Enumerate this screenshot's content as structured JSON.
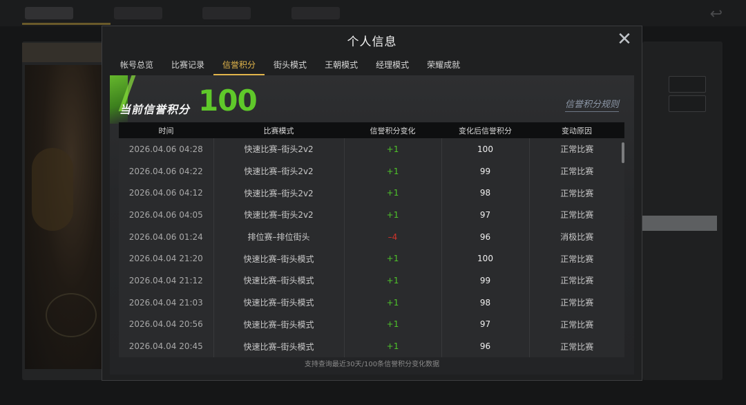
{
  "modal": {
    "title": "个人信息",
    "close_label": "✕",
    "tabs": [
      {
        "label": "帐号总览"
      },
      {
        "label": "比赛记录"
      },
      {
        "label": "信誉积分",
        "active": true
      },
      {
        "label": "街头模式"
      },
      {
        "label": "王朝模式"
      },
      {
        "label": "经理模式"
      },
      {
        "label": "荣耀成就"
      }
    ]
  },
  "credit": {
    "label": "当前信誉积分",
    "value": "100",
    "rules_link": "信誉积分规则"
  },
  "table": {
    "headers": [
      "时间",
      "比赛模式",
      "信誉积分变化",
      "变化后信誉积分",
      "变动原因"
    ],
    "rows": [
      {
        "time": "2026.04.06  04:28",
        "mode": "快速比赛–街头2v2",
        "change": "+1",
        "after": "100",
        "reason": "正常比赛"
      },
      {
        "time": "2026.04.06  04:22",
        "mode": "快速比赛–街头2v2",
        "change": "+1",
        "after": "99",
        "reason": "正常比赛"
      },
      {
        "time": "2026.04.06  04:12",
        "mode": "快速比赛–街头2v2",
        "change": "+1",
        "after": "98",
        "reason": "正常比赛"
      },
      {
        "time": "2026.04.06  04:05",
        "mode": "快速比赛–街头2v2",
        "change": "+1",
        "after": "97",
        "reason": "正常比赛"
      },
      {
        "time": "2026.04.06  01:24",
        "mode": "排位赛–排位街头",
        "change": "–4",
        "after": "96",
        "reason": "消极比赛"
      },
      {
        "time": "2026.04.04  21:20",
        "mode": "快速比赛–街头模式",
        "change": "+1",
        "after": "100",
        "reason": "正常比赛"
      },
      {
        "time": "2026.04.04  21:12",
        "mode": "快速比赛–街头模式",
        "change": "+1",
        "after": "99",
        "reason": "正常比赛"
      },
      {
        "time": "2026.04.04  21:03",
        "mode": "快速比赛–街头模式",
        "change": "+1",
        "after": "98",
        "reason": "正常比赛"
      },
      {
        "time": "2026.04.04  20:56",
        "mode": "快速比赛–街头模式",
        "change": "+1",
        "after": "97",
        "reason": "正常比赛"
      },
      {
        "time": "2026.04.04  20:45",
        "mode": "快速比赛–街头模式",
        "change": "+1",
        "after": "96",
        "reason": "正常比赛"
      }
    ]
  },
  "footer_note": "支持查询最近30天/100条信誉积分变化数据",
  "colors": {
    "accent": "#e2b54b",
    "positive": "#4ec32a",
    "negative": "#d2332b",
    "score": "#5fc82a"
  }
}
